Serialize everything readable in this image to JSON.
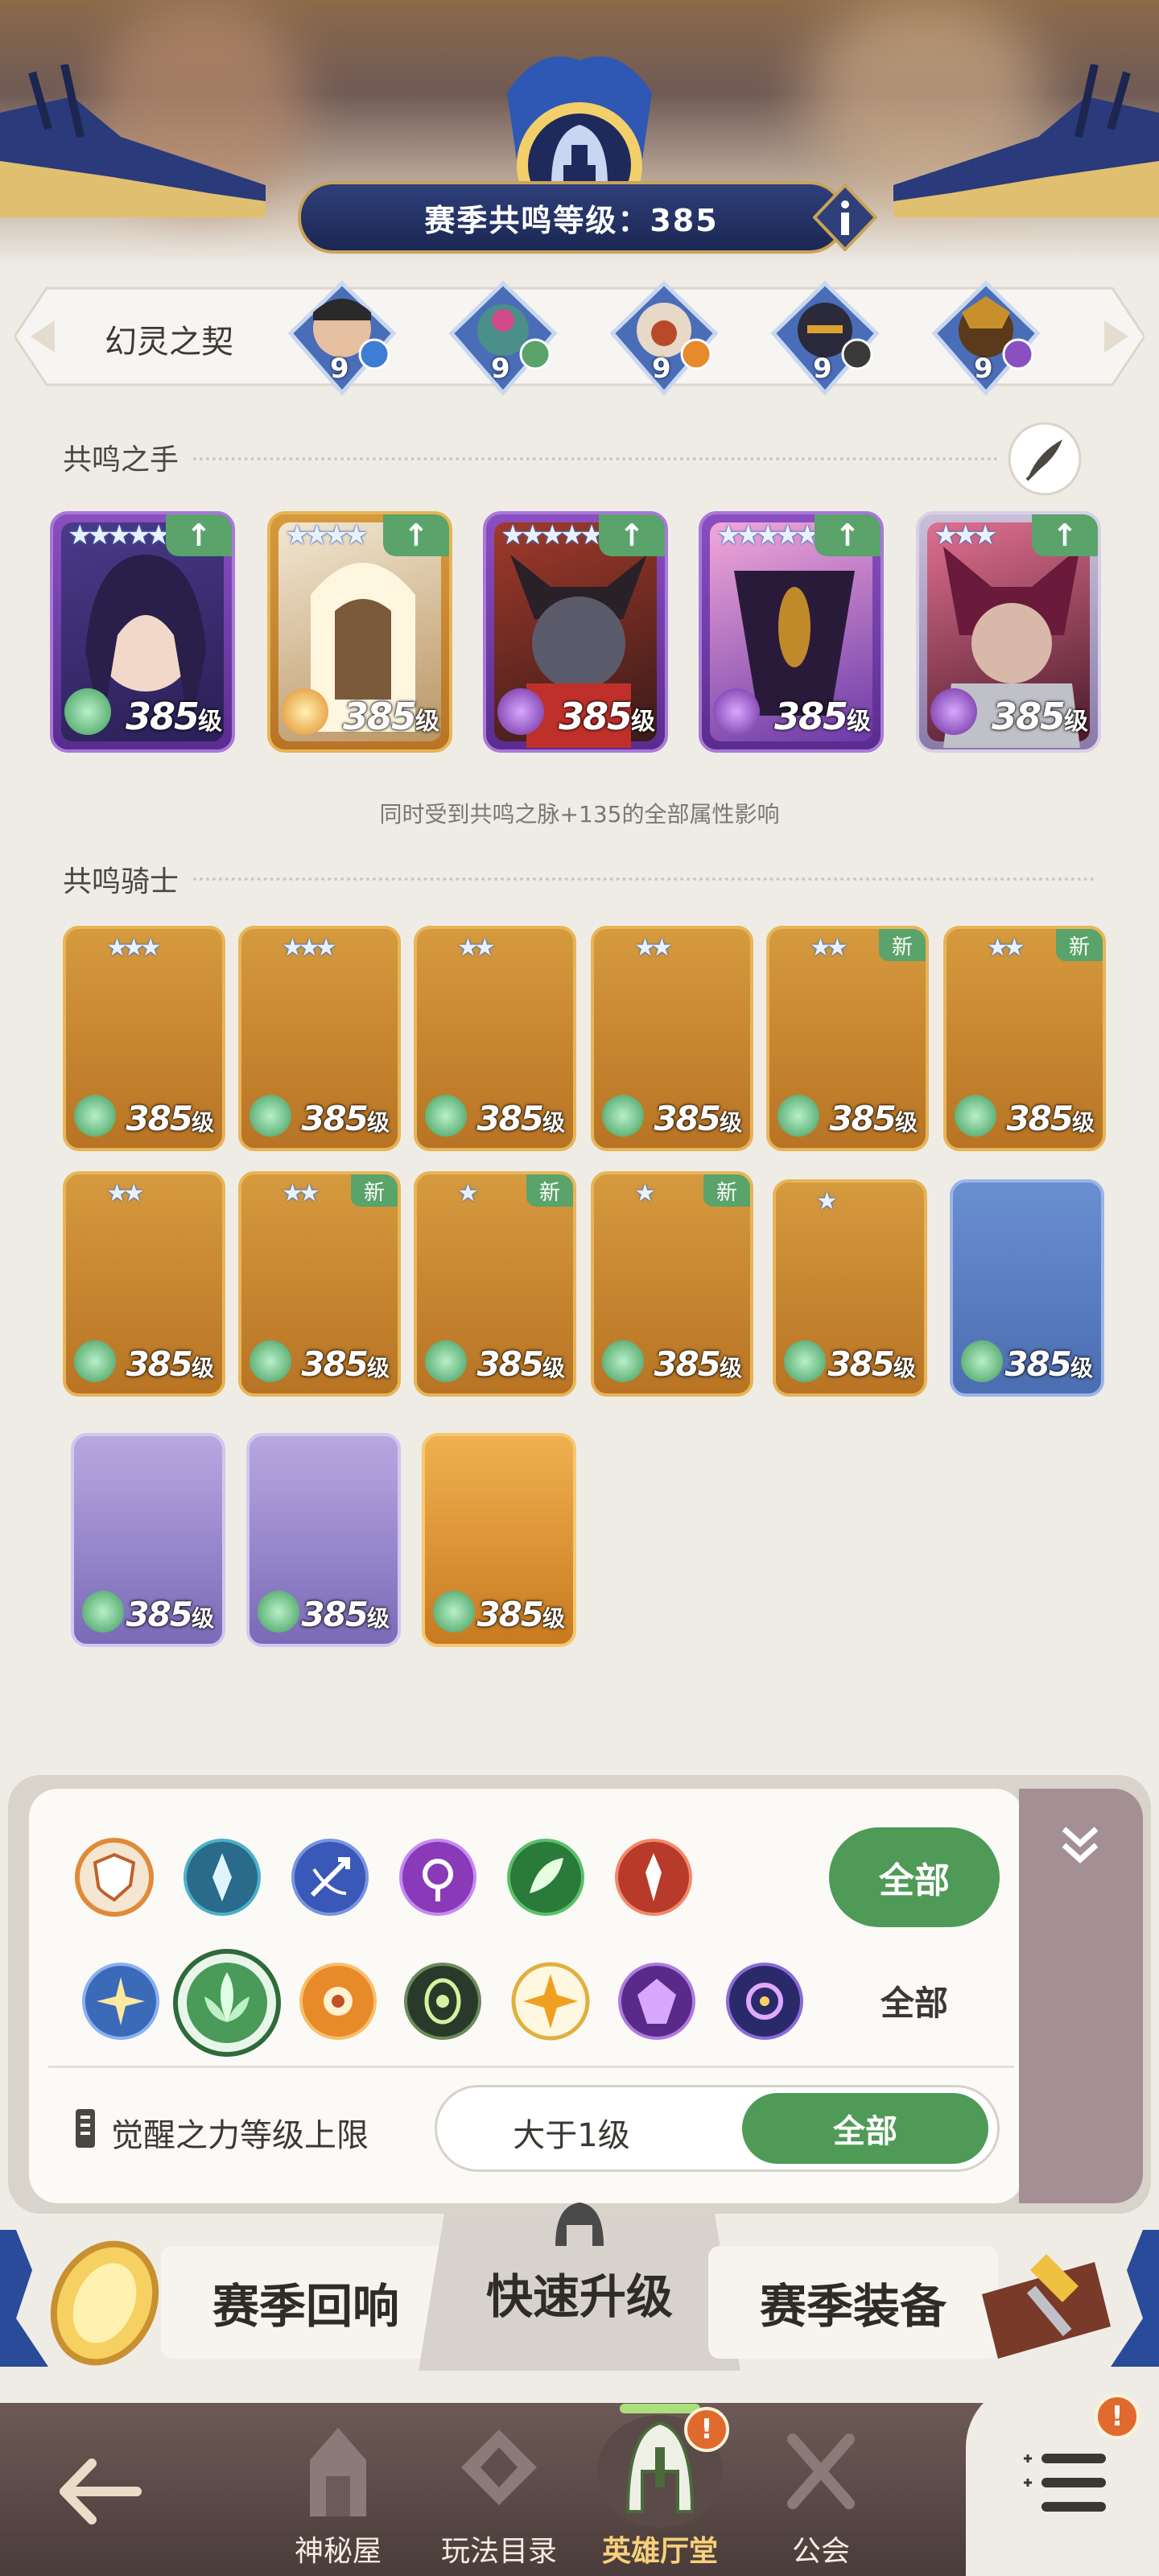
{
  "header": {
    "season_level_label": "赛季共鸣等级：385"
  },
  "contract": {
    "label": "幻灵之契",
    "slots": [
      {
        "level": "9"
      },
      {
        "level": "9"
      },
      {
        "level": "9"
      },
      {
        "level": "9"
      },
      {
        "level": "9"
      }
    ]
  },
  "hand": {
    "title": "共鸣之手",
    "note": "同时受到共鸣之脉+135的全部属性影响",
    "cards": [
      {
        "level": "385",
        "unit": "级"
      },
      {
        "level": "385",
        "unit": "级"
      },
      {
        "level": "385",
        "unit": "级"
      },
      {
        "level": "385",
        "unit": "级"
      },
      {
        "level": "385",
        "unit": "级"
      }
    ]
  },
  "knights": {
    "title": "共鸣骑士",
    "new_label": "新",
    "cards": [
      {
        "level": "385",
        "unit": "级"
      },
      {
        "level": "385",
        "unit": "级"
      },
      {
        "level": "385",
        "unit": "级"
      },
      {
        "level": "385",
        "unit": "级"
      },
      {
        "level": "385",
        "unit": "级"
      },
      {
        "level": "385",
        "unit": "级"
      },
      {
        "level": "385",
        "unit": "级"
      },
      {
        "level": "385",
        "unit": "级"
      },
      {
        "level": "385",
        "unit": "级"
      },
      {
        "level": "385",
        "unit": "级"
      },
      {
        "level": "385",
        "unit": "级"
      },
      {
        "level": "385",
        "unit": "级"
      },
      {
        "level": "385",
        "unit": "级"
      },
      {
        "level": "385",
        "unit": "级"
      },
      {
        "level": "385",
        "unit": "级"
      }
    ]
  },
  "filters": {
    "all_button": "全部",
    "all_text": "全部",
    "awaken_label": "觉醒之力等级上限",
    "awaken_min": "大于1级",
    "awaken_all": "全部"
  },
  "tabs": {
    "left": "赛季回响",
    "center": "快速升级",
    "right": "赛季装备"
  },
  "nav": {
    "items": [
      {
        "label": "神秘屋"
      },
      {
        "label": "玩法目录"
      },
      {
        "label": "英雄厅堂"
      },
      {
        "label": "公会"
      }
    ],
    "badge": "!"
  },
  "colors": {
    "accent_green": "#4f9a56",
    "banner_blue": "#1b2753",
    "badge_orange": "#e06a2e"
  }
}
